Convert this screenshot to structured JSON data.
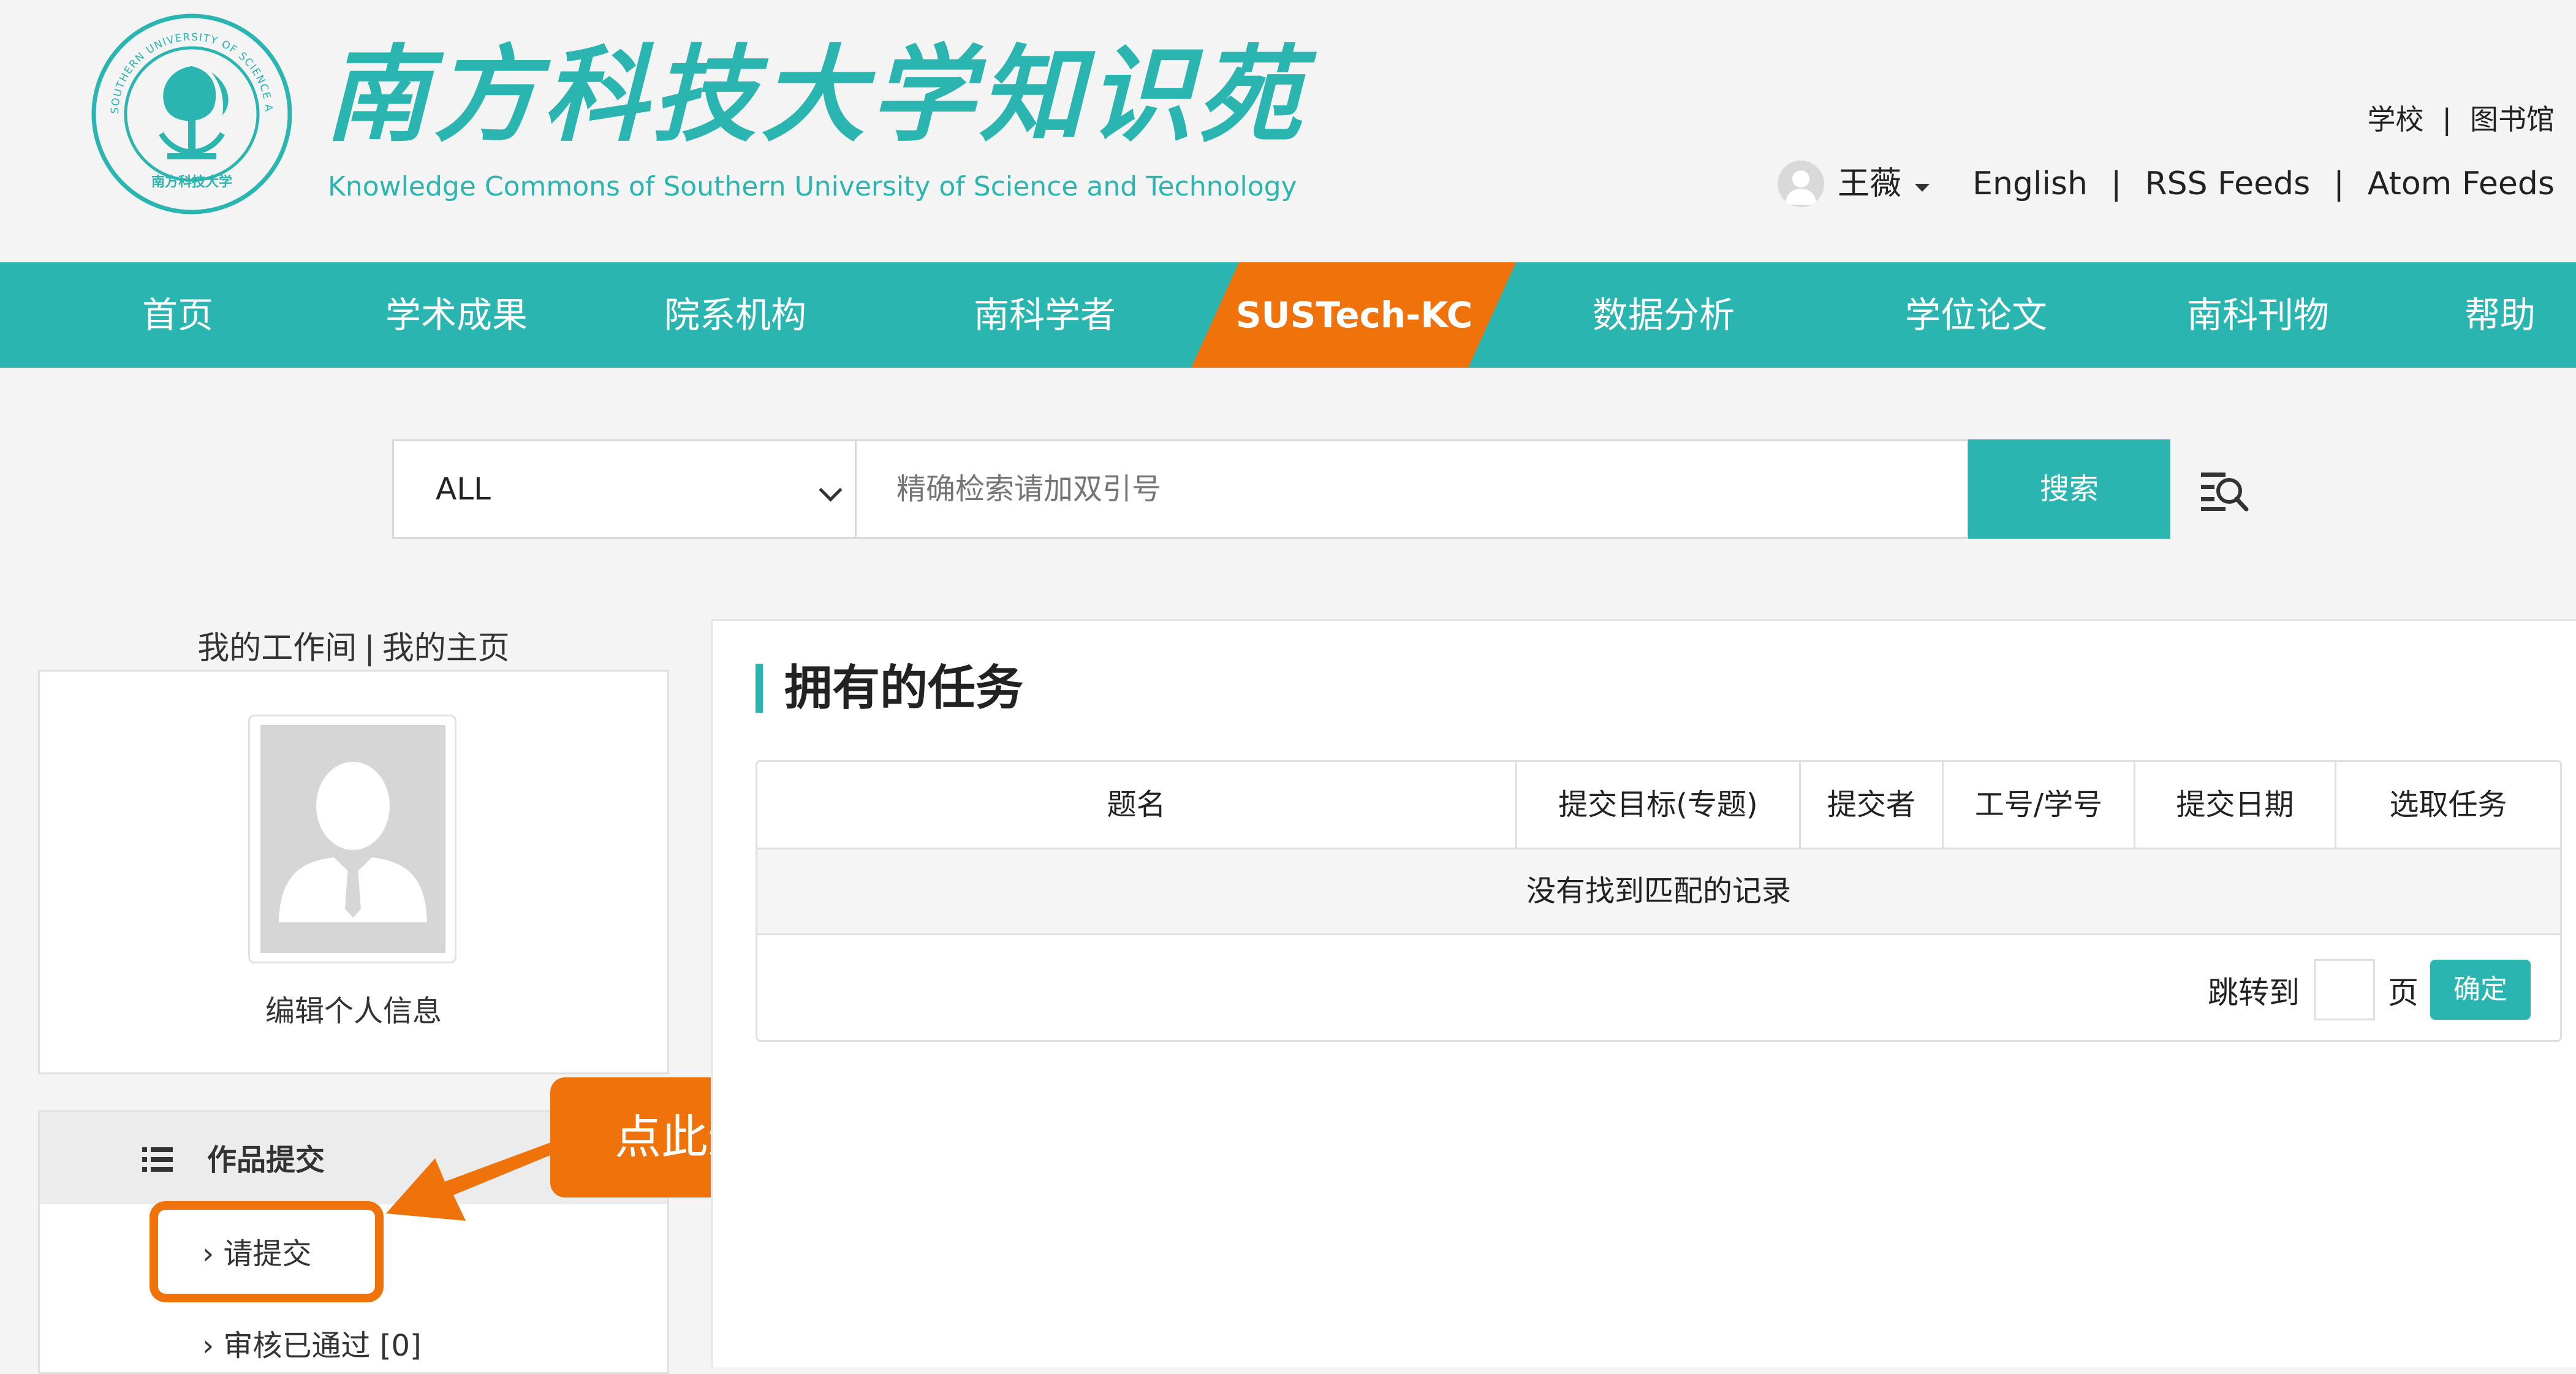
{
  "brand": {
    "title": "南方科技大学知识苑",
    "subtitle": "Knowledge Commons of Southern University of Science and Technology",
    "seal_text_top": "SOUTHERN UNIVERSITY OF SCIENCE AND TECHNOLOGY",
    "seal_text_bottom": "南方科技大学"
  },
  "top_links": {
    "school": "学校",
    "library": "图书馆",
    "separator": "|"
  },
  "user_bar": {
    "username": "王薇",
    "english": "English",
    "rss": "RSS Feeds",
    "atom": "Atom Feeds",
    "separator": "|"
  },
  "nav": {
    "items": [
      "首页",
      "学术成果",
      "院系机构",
      "南科学者",
      "SUSTech-KC",
      "数据分析",
      "学位论文",
      "南科刊物",
      "帮助"
    ],
    "active_index": 4
  },
  "search": {
    "scope_value": "ALL",
    "placeholder": "精确检索请加双引号",
    "button_label": "搜索"
  },
  "sidebar": {
    "workspace_link": "我的工作间",
    "homepage_link": "我的主页",
    "separator": "|",
    "edit_profile": "编辑个人信息",
    "menu_title": "作品提交",
    "submit_item": "› 请提交",
    "approved_item": "›  审核已通过 [0]"
  },
  "callout": {
    "text": "点此进入提交页面"
  },
  "tasks": {
    "title": "拥有的任务",
    "columns": [
      "题名",
      "提交目标(专题)",
      "提交者",
      "工号/学号",
      "提交日期",
      "选取任务"
    ],
    "empty_message": "没有找到匹配的记录",
    "goto_label": "跳转到",
    "page_unit": "页",
    "confirm_label": "确定"
  },
  "colors": {
    "primary_teal": "#2bb5b1",
    "accent_orange": "#f0720b",
    "background": "#f4f4f4"
  }
}
